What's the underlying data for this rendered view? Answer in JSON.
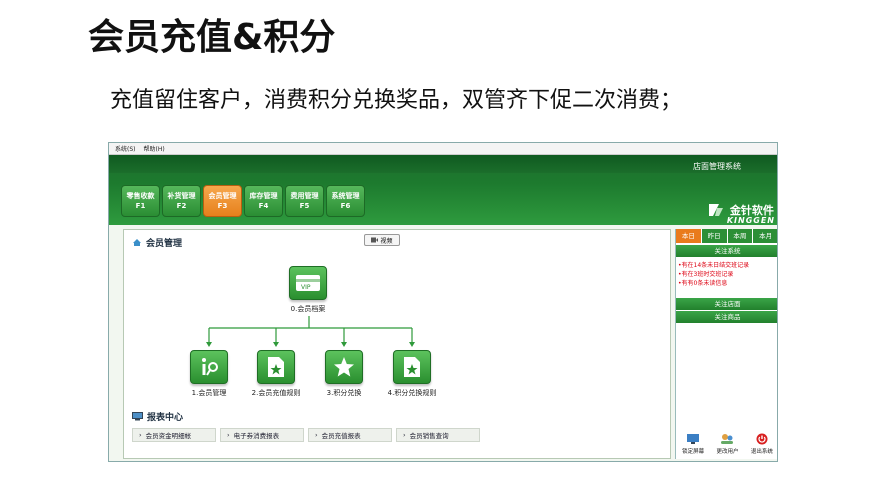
{
  "slide": {
    "title": "会员充值&积分",
    "subtitle": "充值留住客户，消费积分兑换奖品，双管齐下促二次消费；"
  },
  "app": {
    "menu": [
      "系统(S)",
      "帮助(H)"
    ],
    "system_name": "店面管理系统",
    "brand_cn": "金针软件",
    "brand_en": "KINGGEN",
    "modules": [
      {
        "name": "零售收款",
        "key": "F1"
      },
      {
        "name": "补货管理",
        "key": "F2"
      },
      {
        "name": "会员管理",
        "key": "F3"
      },
      {
        "name": "库存管理",
        "key": "F4"
      },
      {
        "name": "费用管理",
        "key": "F5"
      },
      {
        "name": "系统管理",
        "key": "F6"
      }
    ],
    "active_module": 2,
    "section_title": "会员管理",
    "video_label": "视频",
    "tiles": {
      "archive": "0.会员档案",
      "manage": "1.会员管理",
      "recharge_rule": "2.会员充值规则",
      "points_exchange": "3.积分兑换",
      "exchange_rule": "4.积分兑换规则"
    },
    "report_title": "报表中心",
    "reports": [
      "会员资金明细帐",
      "电子券消费报表",
      "会员充值报表",
      "会员销售查询"
    ],
    "side": {
      "tabs": [
        "本日",
        "昨日",
        "本周",
        "本月"
      ],
      "active_tab": 0,
      "system_head": "关注系统",
      "alerts": [
        "•有在14条未日结交班记录",
        "•有在3班时交班记录",
        "•有有0条未读信息"
      ],
      "shop_head": "关注店面",
      "goods_head": "关注商品",
      "footer": [
        "锁定屏幕",
        "更改用户",
        "退出系统"
      ]
    },
    "colors": {
      "header_green": "#1d7a2e",
      "active_orange": "#e97b1c",
      "alert_red": "#d01010"
    }
  }
}
